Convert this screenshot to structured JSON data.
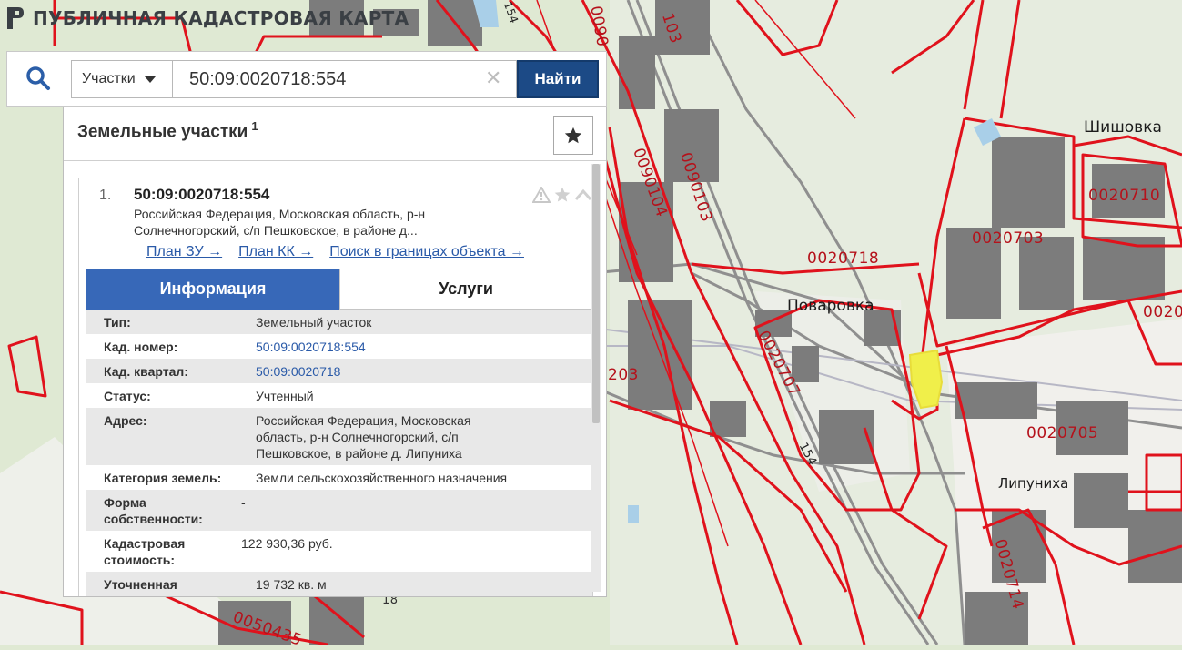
{
  "app": {
    "title": "ПУБЛИЧНАЯ КАДАСТРОВАЯ КАРТА"
  },
  "search": {
    "type_label": "Участки",
    "query": "50:09:0020718:554",
    "find_label": "Найти"
  },
  "results": {
    "title": "Земельные участки",
    "count": "1",
    "item": {
      "index": "1.",
      "cadnum": "50:09:0020718:554",
      "address_short": "Российская Федерация, Московская область, р-н Солнечногорский, с/п Пешковское, в районе д...",
      "links": [
        "План ЗУ →",
        "План КК →",
        "Поиск в границах объекта →"
      ],
      "tabs": [
        "Информация",
        "Услуги"
      ],
      "info": [
        {
          "key": "Тип:",
          "value": "Земельный участок"
        },
        {
          "key": "Кад. номер:",
          "value": "50:09:0020718:554"
        },
        {
          "key": "Кад. квартал:",
          "value": "50:09:0020718"
        },
        {
          "key": "Статус:",
          "value": "Учтенный"
        },
        {
          "key": "Адрес:",
          "value": "Российская Федерация, Московская область, р-н Солнечногорский, с/п Пешковское, в районе д. Липуниха"
        },
        {
          "key": "Категория земель:",
          "value": "Земли сельскохозяйственного назначения"
        },
        {
          "key": "Форма собственности:",
          "value": "-"
        },
        {
          "key": "Кадастровая стоимость:",
          "value": "122 930,36 руб."
        },
        {
          "key": "Уточненная",
          "value": "19 732 кв. м"
        }
      ]
    }
  },
  "map": {
    "quarter_labels": [
      "0020718",
      "0020703",
      "0020710",
      "0020705",
      "0020707",
      "0090104",
      "0090103",
      "0050435",
      "0020714",
      "203",
      "0090",
      "103",
      "154",
      "154",
      "18",
      "0020"
    ],
    "places": [
      "Шишовка",
      "Поваровка",
      "Липуниха"
    ],
    "colors": {
      "boundary": "#e0121c",
      "selected_parcel": "#f0ef4a",
      "building": "#7a7a7a",
      "forest": "#dfe9d3",
      "field": "#f1f0ec"
    }
  }
}
